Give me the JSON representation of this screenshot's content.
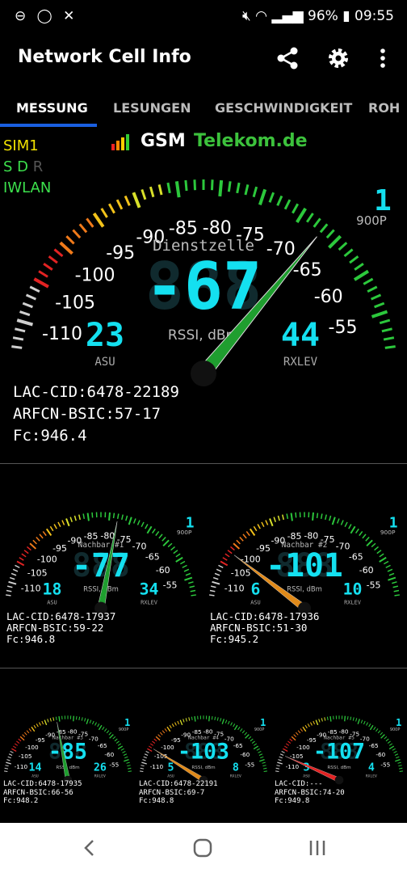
{
  "status_bar": {
    "left_icons": [
      "dnd-icon",
      "whatsapp-icon",
      "xing-icon"
    ],
    "battery": "96%",
    "time": "09:55"
  },
  "app": {
    "title": "Network Cell Info",
    "actions": [
      "share-icon",
      "settings-icon",
      "more-vert-icon"
    ]
  },
  "tabs": [
    {
      "label": "MESSUNG",
      "active": true
    },
    {
      "label": "LESUNGEN",
      "active": false
    },
    {
      "label": "GESCHWINDIGKEIT",
      "active": false
    },
    {
      "label": "ROH",
      "active": false
    }
  ],
  "sim": {
    "sim1": "SIM1",
    "sd": "S D",
    "r": "R",
    "iwlan": "IWLAN",
    "tech": "GSM",
    "operator": "Telekom.de",
    "colors": {
      "sim1": "#f2e200",
      "sd": "#3ce04c",
      "r": "#555555",
      "iwlan": "#3ce04c",
      "operator": "#3cc23c"
    }
  },
  "gauges": [
    {
      "id": "main",
      "title": "Dienstzelle",
      "value": "-67",
      "unit": "RSSI, dBm",
      "asu": "23",
      "asu_label": "ASU",
      "rxlev": "44",
      "rxlev_label": "RXLEV",
      "band": "1",
      "band_label": "900P",
      "needle_value": -67,
      "needle_color": "#1f9e2f",
      "ticks": [
        "-110",
        "-105",
        "-100",
        "-95",
        "-90",
        "-85",
        "-80",
        "-75",
        "-70",
        "-65",
        "-60",
        "-55"
      ],
      "info": {
        "lac": "LAC-CID:6478-22189",
        "arfcn": "ARFCN-BSIC:57-17",
        "fc": "Fc:946.4"
      }
    },
    {
      "id": "n1",
      "title": "Nachbar #1",
      "value": "-77",
      "unit": "RSSI, dBm",
      "asu": "18",
      "asu_label": "ASU",
      "rxlev": "34",
      "rxlev_label": "RXLEV",
      "band": "1",
      "band_label": "900P",
      "needle_value": -78,
      "needle_color": "#1f9e2f",
      "ticks": [
        "-110",
        "-105",
        "-100",
        "-95",
        "-90",
        "-85",
        "-80",
        "-75",
        "-70",
        "-65",
        "-60",
        "-55"
      ],
      "info": {
        "lac": "LAC-CID:6478-17937",
        "arfcn": "ARFCN-BSIC:59-22",
        "fc": "Fc:946.8"
      }
    },
    {
      "id": "n2",
      "title": "Nachbar #2",
      "value": "-101",
      "unit": "RSSI, dBm",
      "asu": "6",
      "asu_label": "ASU",
      "rxlev": "10",
      "rxlev_label": "RXLEV",
      "band": "1",
      "band_label": "900P",
      "needle_value": -102,
      "needle_color": "#e08a1a",
      "ticks": [
        "-110",
        "-105",
        "-100",
        "-95",
        "-90",
        "-85",
        "-80",
        "-75",
        "-70",
        "-65",
        "-60",
        "-55"
      ],
      "info": {
        "lac": "LAC-CID:6478-17936",
        "arfcn": "ARFCN-BSIC:51-30",
        "fc": "Fc:945.2"
      }
    },
    {
      "id": "n3",
      "title": "Nachbar #3",
      "value": "-85",
      "unit": "RSSI, dBm",
      "asu": "14",
      "asu_label": "ASU",
      "rxlev": "26",
      "rxlev_label": "RXLEV",
      "band": "1",
      "band_label": "900P",
      "needle_value": -86,
      "needle_color": "#1f9e2f",
      "ticks": [
        "-110",
        "-105",
        "-100",
        "-95",
        "-90",
        "-85",
        "-80",
        "-75",
        "-70",
        "-65",
        "-60",
        "-55"
      ],
      "info": {
        "lac": "LAC-CID:6478-17935",
        "arfcn": "ARFCN-BSIC:66-56",
        "fc": "Fc:948.2"
      }
    },
    {
      "id": "n4",
      "title": "Nachbar #4",
      "value": "-103",
      "unit": "RSSI, dBm",
      "asu": "5",
      "asu_label": "ASU",
      "rxlev": "8",
      "rxlev_label": "RXLEV",
      "band": "1",
      "band_label": "900P",
      "needle_value": -104,
      "needle_color": "#e08a1a",
      "ticks": [
        "-110",
        "-105",
        "-100",
        "-95",
        "-90",
        "-85",
        "-80",
        "-75",
        "-70",
        "-65",
        "-60",
        "-55"
      ],
      "info": {
        "lac": "LAC-CID:6478-22191",
        "arfcn": "ARFCN-BSIC:69-7",
        "fc": "Fc:948.8"
      }
    },
    {
      "id": "n5",
      "title": "Nachbar #5",
      "value": "-107",
      "unit": "RSSI, dBm",
      "asu": "3",
      "asu_label": "ASU",
      "rxlev": "4",
      "rxlev_label": "RXLEV",
      "band": "1",
      "band_label": "900P",
      "needle_value": -107,
      "needle_color": "#e22323",
      "ticks": [
        "-110",
        "-105",
        "-100",
        "-95",
        "-90",
        "-85",
        "-80",
        "-75",
        "-70",
        "-65",
        "-60",
        "-55"
      ],
      "info": {
        "lac": "LAC-CID:---",
        "arfcn": "ARFCN-BSIC:74-20",
        "fc": "Fc:949.8"
      }
    }
  ],
  "nav": [
    "back-icon",
    "home-icon",
    "recents-icon"
  ]
}
